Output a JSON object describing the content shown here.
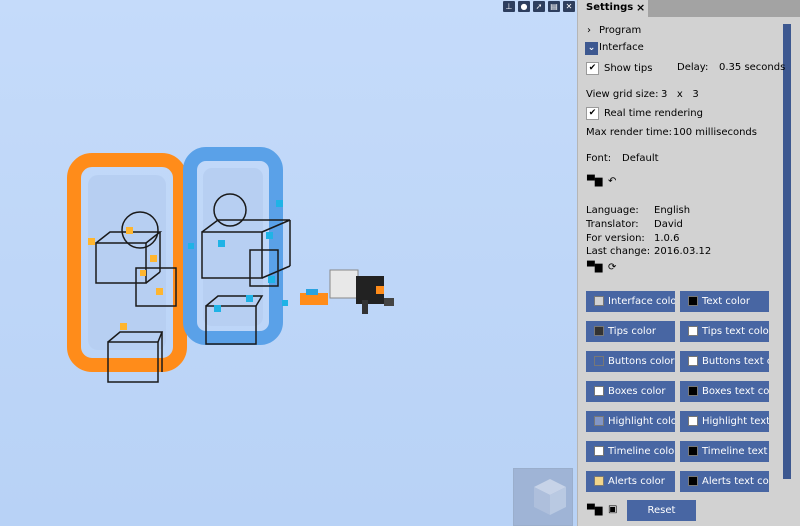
{
  "viewport": {
    "top_icons": [
      "axis-icon",
      "sphere-icon",
      "cursor-icon",
      "keyboard-icon",
      "close-icon"
    ]
  },
  "settings": {
    "tab_title": "Settings",
    "tab_close": "×",
    "program_label": "Program",
    "interface_label": "Interface",
    "show_tips_label": "Show tips",
    "show_tips_checked": "✔",
    "delay_label": "Delay:",
    "delay_value": "0.35 seconds",
    "view_grid_label": "View grid size:",
    "view_grid_value": "3   x   3",
    "realtime_label": "Real time rendering",
    "realtime_checked": "✔",
    "max_render_label": "Max render time:",
    "max_render_value": "100 milliseconds",
    "font_label": "Font:",
    "font_value": "Default",
    "language_label": "Language:",
    "language_value": "English",
    "translator_label": "Translator:",
    "translator_value": "David",
    "version_label": "For version:",
    "version_value": "1.0.6",
    "last_change_label": "Last change:",
    "last_change_value": "2016.03.12",
    "color_buttons": [
      {
        "label": "Interface color",
        "swatch": "#d2d2d2"
      },
      {
        "label": "Text color",
        "swatch": "#000000"
      },
      {
        "label": "Tips color",
        "swatch": "#333333"
      },
      {
        "label": "Tips text color",
        "swatch": "#ffffff"
      },
      {
        "label": "Buttons color",
        "swatch": "#4866a3"
      },
      {
        "label": "Buttons text color",
        "swatch": "#ffffff"
      },
      {
        "label": "Boxes color",
        "swatch": "#ffffff"
      },
      {
        "label": "Boxes text color",
        "swatch": "#000000"
      },
      {
        "label": "Highlight color",
        "swatch": "#8296c6"
      },
      {
        "label": "Highlight text color",
        "swatch": "#ffffff"
      },
      {
        "label": "Timeline color",
        "swatch": "#ffffff"
      },
      {
        "label": "Timeline text color",
        "swatch": "#000000"
      },
      {
        "label": "Alerts color",
        "swatch": "#f2d58a"
      },
      {
        "label": "Alerts text color",
        "swatch": "#000000"
      }
    ],
    "reset_label": "Reset"
  }
}
